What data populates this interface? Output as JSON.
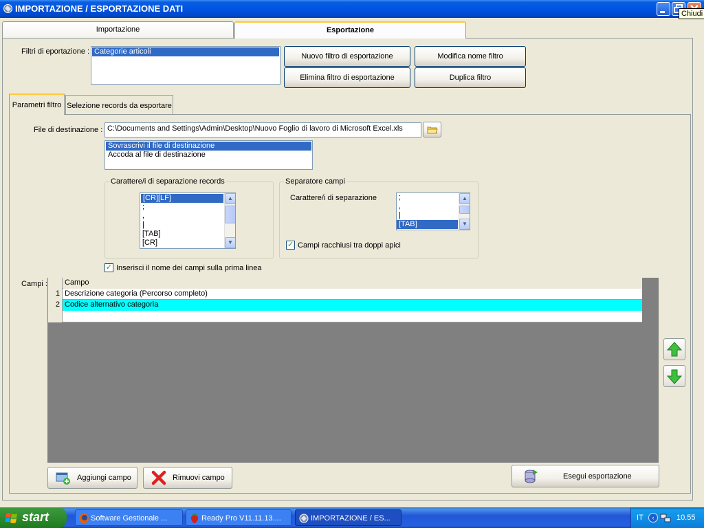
{
  "window": {
    "title": "IMPORTAZIONE / ESPORTAZIONE DATI",
    "close_tooltip": "Chiudi"
  },
  "tabs": {
    "import": "Importazione",
    "export": "Esportazione"
  },
  "filters": {
    "label": "Filtri di eportazione :",
    "items": [
      "Categorie articoli"
    ],
    "buttons": {
      "new": "Nuovo filtro di esportazione",
      "delete": "Elimina filtro di esportazione",
      "rename": "Modifica nome filtro",
      "duplicate": "Duplica filtro"
    }
  },
  "inner_tabs": {
    "params": "Parametri filtro",
    "records": "Selezione records da esportare"
  },
  "destination": {
    "label": "File di destinazione :",
    "path": "C:\\Documents and Settings\\Admin\\Desktop\\Nuovo Foglio di lavoro di Microsoft Excel.xls",
    "modes": [
      "Sovrascrivi il file di destinazione",
      "Accoda al file di destinazione"
    ]
  },
  "record_separator": {
    "legend": "Carattere/i di separazione records",
    "items": [
      "[CR][LF]",
      ";",
      ",",
      "|",
      "[TAB]",
      "[CR]"
    ]
  },
  "field_separator": {
    "legend": "Separatore campi",
    "chars_label": "Carattere/i di separazione",
    "items": [
      ";",
      ",",
      "|",
      "[TAB]"
    ],
    "quotes_label": "Campi racchiusi tra doppi apici"
  },
  "header_check_label": "Inserisci il nome dei campi sulla prima linea",
  "fields": {
    "label": "Campi :",
    "column": "Campo",
    "rows": [
      {
        "n": "1",
        "campo": "Descrizione categoria (Percorso completo)"
      },
      {
        "n": "2",
        "campo": "Codice alternativo categoria"
      }
    ]
  },
  "bottom_buttons": {
    "add": "Aggiungi campo",
    "remove": "Rimuovi campo",
    "run": "Esegui esportazione"
  },
  "taskbar": {
    "start": "start",
    "tasks": [
      "Software Gestionale ...",
      "Ready Pro V11.11.13....",
      "IMPORTAZIONE / ES..."
    ],
    "lang": "IT",
    "clock": "10.55"
  }
}
